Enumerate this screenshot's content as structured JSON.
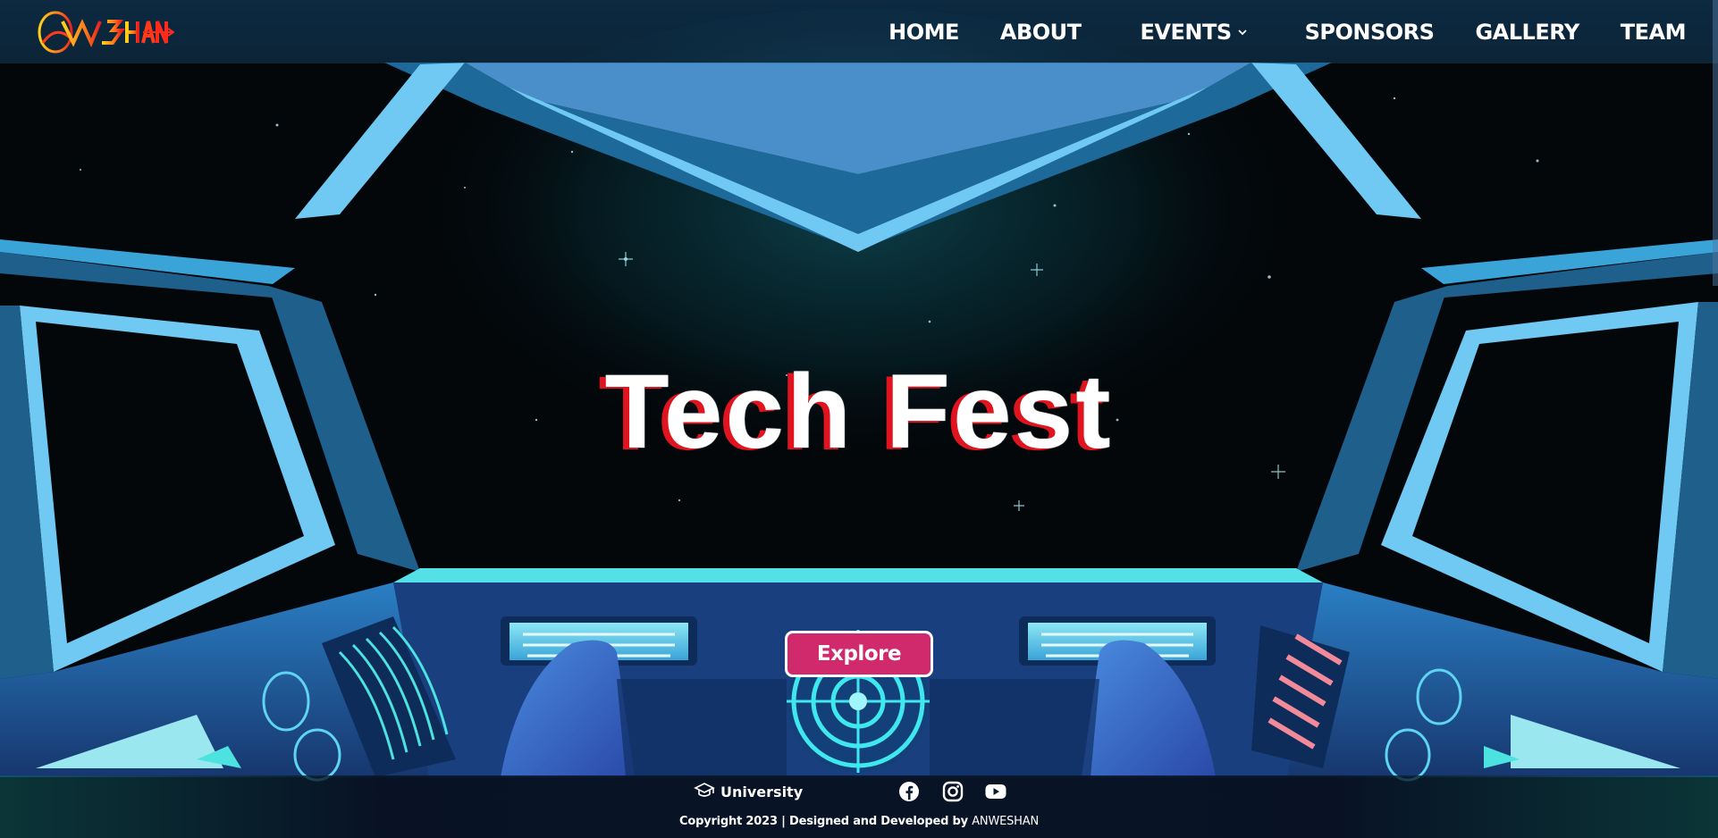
{
  "brand": {
    "logo_text": "ANWESHAN"
  },
  "nav": {
    "items": [
      {
        "label": "HOME"
      },
      {
        "label": "ABOUT"
      },
      {
        "label": "EVENTS",
        "has_dropdown": true
      },
      {
        "label": "SPONSORS"
      },
      {
        "label": "GALLERY"
      },
      {
        "label": "TEAM"
      }
    ]
  },
  "hero": {
    "title": "Tech Fest",
    "button_label": "Explore"
  },
  "footer": {
    "university_label": "University",
    "university_icon": "graduation-cap-icon",
    "social": [
      "facebook-icon",
      "instagram-icon",
      "youtube-icon"
    ],
    "copyright_prefix": "Copyright 2023 | Designed and Developed by ",
    "copyright_brand": "ANWESHAN"
  },
  "colors": {
    "accent": "#d12a6c",
    "title_shadow": "#e0141e",
    "frame_light": "#6fc9f2",
    "frame_dark": "#1e5f8c",
    "console": "#1d4f8f"
  }
}
